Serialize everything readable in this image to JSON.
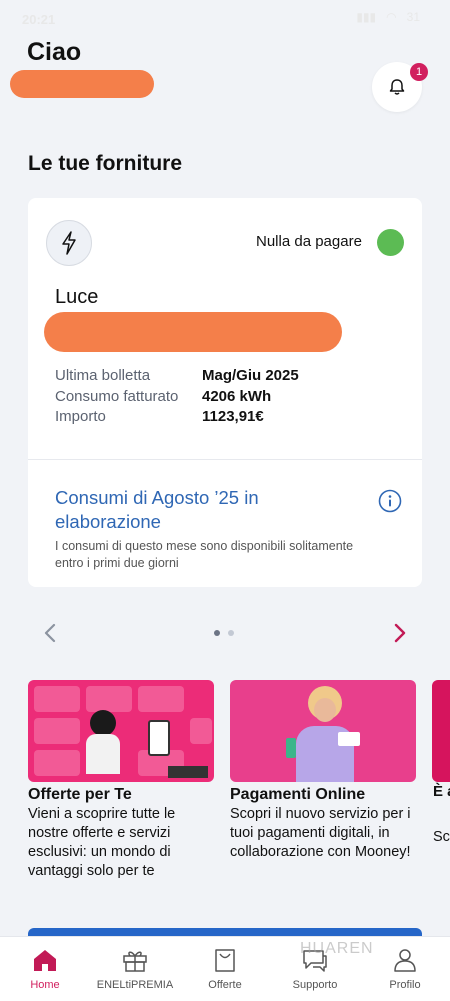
{
  "status_bar": {
    "time": "20:21",
    "battery": "31"
  },
  "header": {
    "greeting": "Ciao",
    "notification_count": "1"
  },
  "supplies": {
    "section_title": "Le tue forniture",
    "card": {
      "status_text": "Nulla da pagare",
      "supply_name": "Luce",
      "rows": [
        {
          "label": "Ultima bolletta",
          "value": "Mag/Giu 2025"
        },
        {
          "label": "Consumo fatturato",
          "value": "4206 kWh"
        },
        {
          "label": "Importo",
          "value": "1123,91€"
        }
      ],
      "consumi_title": "Consumi di Agosto ’25 in elaborazione",
      "consumi_note": "I consumi di questo mese sono disponibili solitamente entro i primi due giorni"
    }
  },
  "carousel": {
    "page_count": 2,
    "active_index": 0
  },
  "promos": [
    {
      "title": "Offerte per Te",
      "description": "Vieni a scoprire tutte le nostre offerte e servizi esclusivi: un mondo di vantaggi solo per te"
    },
    {
      "title": "Pagamenti Online",
      "description": "Scopri il nuovo servizio per i tuoi pagamenti digitali, in collaborazione con Mooney!"
    }
  ],
  "partial_promo": {
    "title": "È a bo",
    "description": "Sc luc im"
  },
  "tabbar": {
    "tabs": [
      {
        "label": "Home",
        "icon": "home-icon",
        "active": true
      },
      {
        "label": "ENELtiPREMIA",
        "icon": "gift-icon",
        "active": false
      },
      {
        "label": "Offerte",
        "icon": "shopping-bag-icon",
        "active": false
      },
      {
        "label": "Supporto",
        "icon": "chat-support-icon",
        "active": false
      },
      {
        "label": "Profilo",
        "icon": "user-icon",
        "active": false
      }
    ]
  },
  "watermark": "HUAREN",
  "colors": {
    "accent": "#d11f5e",
    "link": "#2f67b4",
    "status_ok": "#5cbb54",
    "background": "#f1f3f7"
  }
}
